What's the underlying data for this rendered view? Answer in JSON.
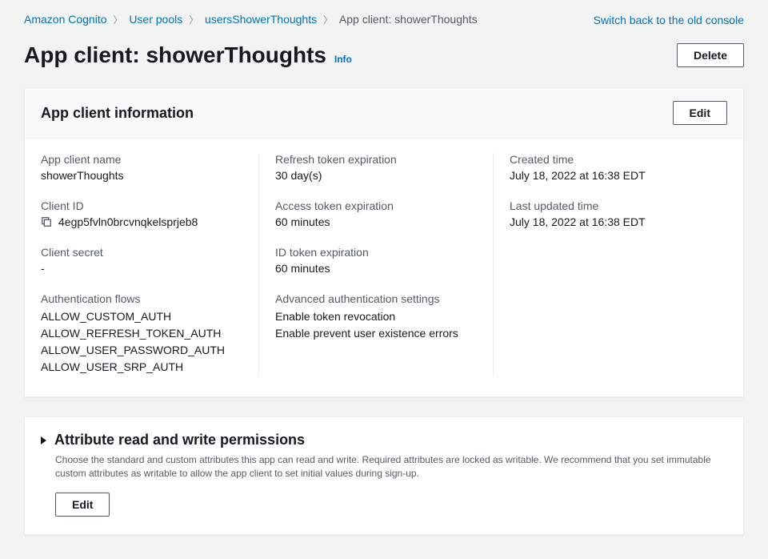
{
  "topbar": {
    "switch_link": "Switch back to the old console"
  },
  "breadcrumbs": {
    "cognito": "Amazon Cognito",
    "userpools": "User pools",
    "pool": "usersShowerThoughts",
    "current": "App client: showerThoughts"
  },
  "title": {
    "h1": "App client: showerThoughts",
    "info": "Info",
    "delete": "Delete"
  },
  "info_panel": {
    "header": "App client information",
    "edit": "Edit",
    "col1": {
      "name_label": "App client name",
      "name_value": "showerThoughts",
      "id_label": "Client ID",
      "id_value": "4egp5fvln0brcvnqkelsprjeb8",
      "secret_label": "Client secret",
      "secret_value": "-",
      "flows_label": "Authentication flows",
      "flows": [
        "ALLOW_CUSTOM_AUTH",
        "ALLOW_REFRESH_TOKEN_AUTH",
        "ALLOW_USER_PASSWORD_AUTH",
        "ALLOW_USER_SRP_AUTH"
      ]
    },
    "col2": {
      "refresh_label": "Refresh token expiration",
      "refresh_value": "30 day(s)",
      "access_label": "Access token expiration",
      "access_value": "60 minutes",
      "idtoken_label": "ID token expiration",
      "idtoken_value": "60 minutes",
      "adv_label": "Advanced authentication settings",
      "adv": [
        "Enable token revocation",
        "Enable prevent user existence errors"
      ]
    },
    "col3": {
      "created_label": "Created time",
      "created_value": "July 18, 2022 at 16:38 EDT",
      "updated_label": "Last updated time",
      "updated_value": "July 18, 2022 at 16:38 EDT"
    }
  },
  "attr_panel": {
    "header": "Attribute read and write permissions",
    "desc": "Choose the standard and custom attributes this app can read and write. Required attributes are locked as writable. We recommend that you set immutable custom attributes as writable to allow the app client to set initial values during sign-up.",
    "edit": "Edit"
  }
}
